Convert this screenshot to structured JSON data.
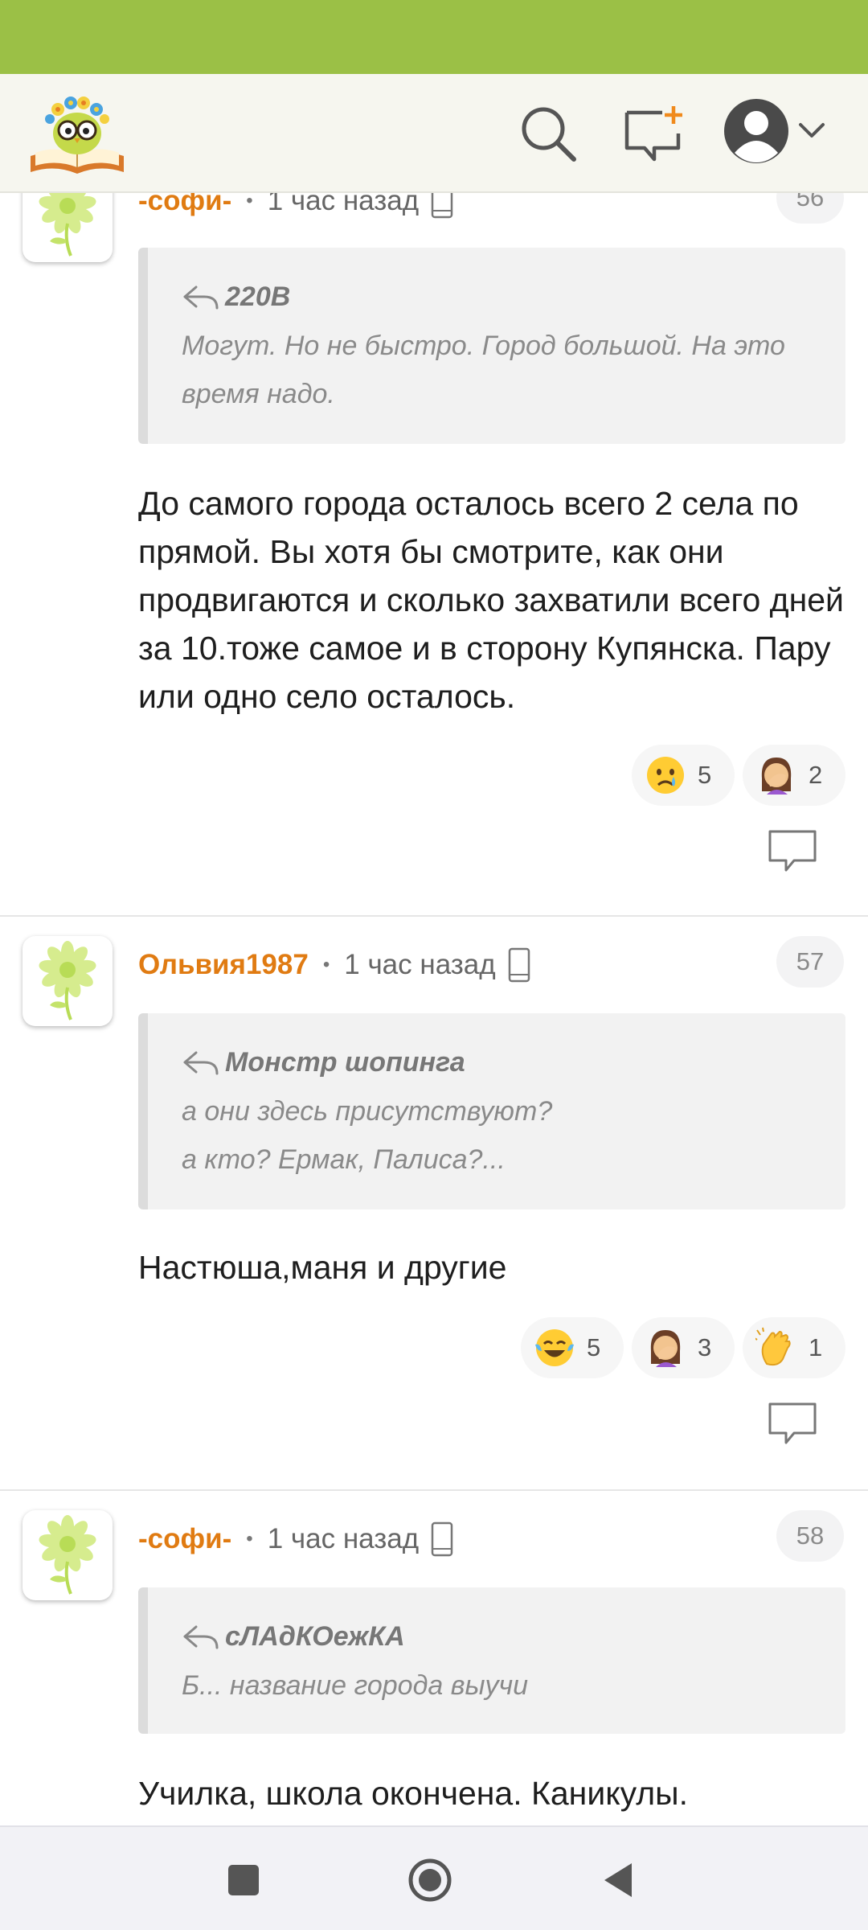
{
  "app": {
    "logo_icon": "owl-on-book-logo",
    "header_icons": [
      "search-icon",
      "new-post-icon",
      "profile-avatar-icon",
      "chevron-down-icon"
    ],
    "colors": {
      "status_bar": "#9bc046",
      "header_bg": "#f6f6ef",
      "author": "#e07b12",
      "accent": "#f08a1c"
    }
  },
  "comments": [
    {
      "author": "-софи-",
      "separator": "•",
      "time": "1 час назад",
      "number": "56",
      "quote_author": "220В",
      "quote_text": "Могут. Но не быстро. Город большой. На это время надо.",
      "text": "До самого города осталось всего 2 села по прямой. Вы хотя бы смотрите, как они продвигаются и сколько захватили всего дней за 10.тоже самое и в сторону Купянска. Пару или одно село осталось.",
      "reactions": [
        {
          "emoji": "crying-face",
          "count": "5"
        },
        {
          "emoji": "woman-facepalming",
          "count": "2"
        }
      ]
    },
    {
      "author": "Ольвия1987",
      "separator": "•",
      "time": "1 час назад",
      "number": "57",
      "quote_author": "Монстр шопинга",
      "quote_text": "а они здесь присутствуют?\nа кто? Ермак, Палиса?...",
      "text": "Настюша,маня и другие",
      "reactions": [
        {
          "emoji": "face-with-tears-of-joy",
          "count": "5"
        },
        {
          "emoji": "woman-facepalming",
          "count": "3"
        },
        {
          "emoji": "clapping-hands",
          "count": "1"
        }
      ]
    },
    {
      "author": "-софи-",
      "separator": "•",
      "time": "1 час назад",
      "number": "58",
      "quote_author": "сЛАдКОежКА",
      "quote_text": "Б... название города выучи",
      "text": "Училка, школа окончена. Каникулы."
    }
  ],
  "navigation": {
    "buttons": [
      "recent-apps",
      "home",
      "back"
    ]
  }
}
